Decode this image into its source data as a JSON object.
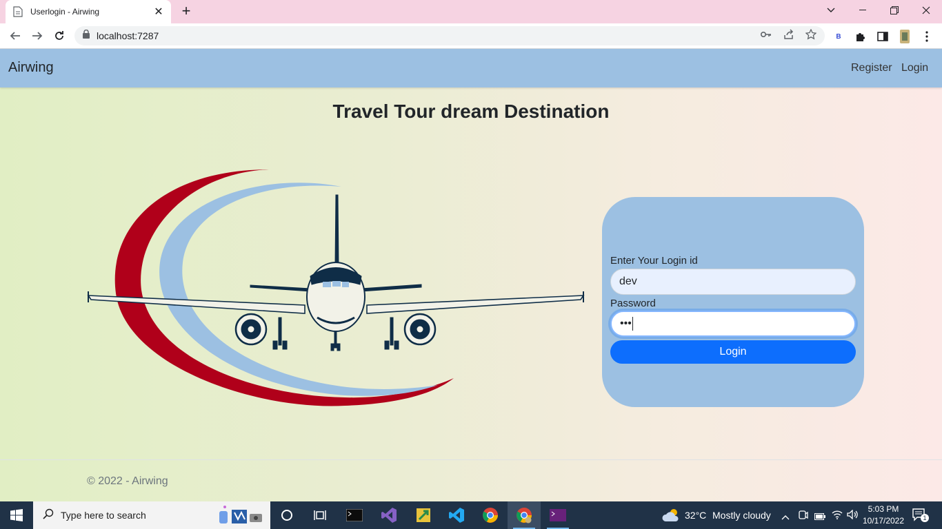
{
  "browser": {
    "tab_title": "Userlogin - Airwing",
    "url": "localhost:7287",
    "extension_letter": "B"
  },
  "app": {
    "brand": "Airwing",
    "nav": {
      "register": "Register",
      "login": "Login"
    },
    "heading": "Travel Tour dream Destination",
    "form": {
      "login_label": "Enter Your Login id",
      "login_value": "dev",
      "password_label": "Password",
      "password_value": "•••",
      "submit_label": "Login"
    },
    "footer": "© 2022 - Airwing"
  },
  "colors": {
    "navbar": "#9cc0e2",
    "primary_button": "#0d6efd",
    "swoosh_red": "#b0001a",
    "swoosh_blue": "#9cc0e2",
    "plane": "#0f2d47"
  },
  "taskbar": {
    "search_placeholder": "Type here to search",
    "weather_temp": "32°C",
    "weather_text": "Mostly cloudy",
    "time": "5:03 PM",
    "date": "10/17/2022",
    "notification_count": "1"
  }
}
